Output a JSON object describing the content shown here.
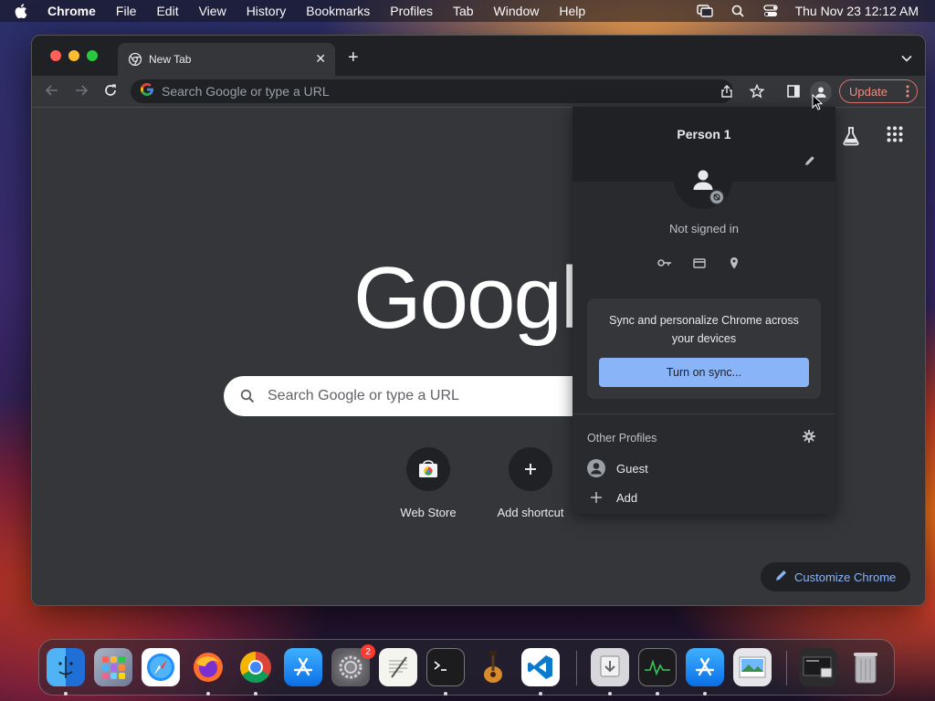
{
  "menubar": {
    "app_name": "Chrome",
    "menus": [
      "File",
      "Edit",
      "View",
      "History",
      "Bookmarks",
      "Profiles",
      "Tab",
      "Window",
      "Help"
    ],
    "clock": "Thu Nov 23  12:12 AM"
  },
  "browser": {
    "tab_title": "New Tab",
    "omnibox_placeholder": "Search Google or type a URL",
    "update_label": "Update"
  },
  "ntp": {
    "logo_text": "Google",
    "search_placeholder": "Search Google or type a URL",
    "shortcuts": [
      {
        "label": "Web Store",
        "icon": "web-store-icon"
      },
      {
        "label": "Add shortcut",
        "icon": "plus-icon"
      }
    ],
    "customize_label": "Customize Chrome"
  },
  "profile_popup": {
    "name": "Person 1",
    "status": "Not signed in",
    "sync_text": "Sync and personalize Chrome across your devices",
    "sync_button": "Turn on sync...",
    "other_profiles_label": "Other Profiles",
    "profiles": [
      {
        "label": "Guest",
        "icon": "guest-avatar-icon"
      },
      {
        "label": "Add",
        "icon": "plus-icon"
      }
    ]
  },
  "dock": {
    "apps": [
      "finder",
      "launchpad",
      "safari",
      "firefox",
      "chrome",
      "app-store",
      "system-settings",
      "textedit",
      "terminal",
      "garageband",
      "vscode",
      "downloads",
      "activity-monitor",
      "xcode-installer",
      "preview",
      "desktop-stack",
      "trash"
    ],
    "settings_badge": "2"
  },
  "colors": {
    "chrome_dark": "#202124",
    "toolbar": "#35363a",
    "accent_blue": "#8ab4f8",
    "update_red": "#f28b82"
  }
}
